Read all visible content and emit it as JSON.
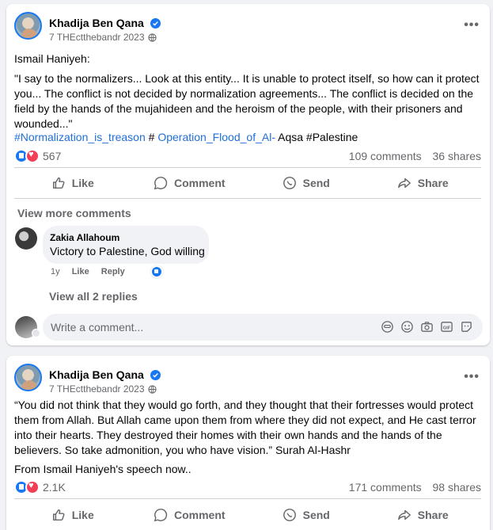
{
  "colors": {
    "accent": "#1877f2",
    "hashtag": "#216fdb",
    "love": "#f33e58",
    "muted": "#65676b"
  },
  "post1": {
    "author": "Khadija Ben Qana",
    "meta": "7 THEctthebandr 2023",
    "intro": "Ismail Haniyeh:",
    "body": "\"I say to the normalizers... Look at this entity... It is unable to protect itself, so how can it protect you... The conflict is not decided by normalization agreements... The conflict is decided on the field by the hands of the mujahideen and the heroism of the people, with their prisoners and wounded...\"",
    "hashtag1": "#Normalization_is_treason",
    "hash_sep": " # ",
    "hashtag2": "Operation_Flood_of_Al-",
    "hashtag2_rest": " Aqsa ",
    "hashtag3": "#Palestine",
    "reaction_count": "567",
    "comments": "109 comments",
    "shares": "36 shares",
    "view_more": "View more comments",
    "comment": {
      "author": "Zakia Allahoum",
      "text": "Victory to Palestine, God willing",
      "time": "1y",
      "like": "Like",
      "reply": "Reply"
    },
    "view_replies": "View all 2 replies",
    "write_placeholder": "Write a comment..."
  },
  "post2": {
    "author": "Khadija Ben Qana",
    "meta": "7 THEctthebandr 2023",
    "body": "“You did not think that they would go forth, and they thought that their fortresses would protect them from Allah. But Allah came upon them from where they did not expect, and He cast terror into their hearts. They destroyed their homes with their own hands and the hands of the believers. So take admonition, you who have vision.” Surah Al-Hashr",
    "footnote": "From Ismail Haniyeh's speech now..",
    "reaction_count": "2.1K",
    "comments": "171 comments",
    "shares": "98 shares"
  },
  "actions": {
    "like": "Like",
    "comment": "Comment",
    "send": "Send",
    "share": "Share"
  },
  "icons": [
    "verified-badge-icon",
    "globe-icon",
    "more-options-icon",
    "like-icon",
    "comment-icon",
    "send-icon",
    "share-icon",
    "emoji-icon",
    "camera-icon",
    "gif-icon",
    "sticker-icon"
  ]
}
